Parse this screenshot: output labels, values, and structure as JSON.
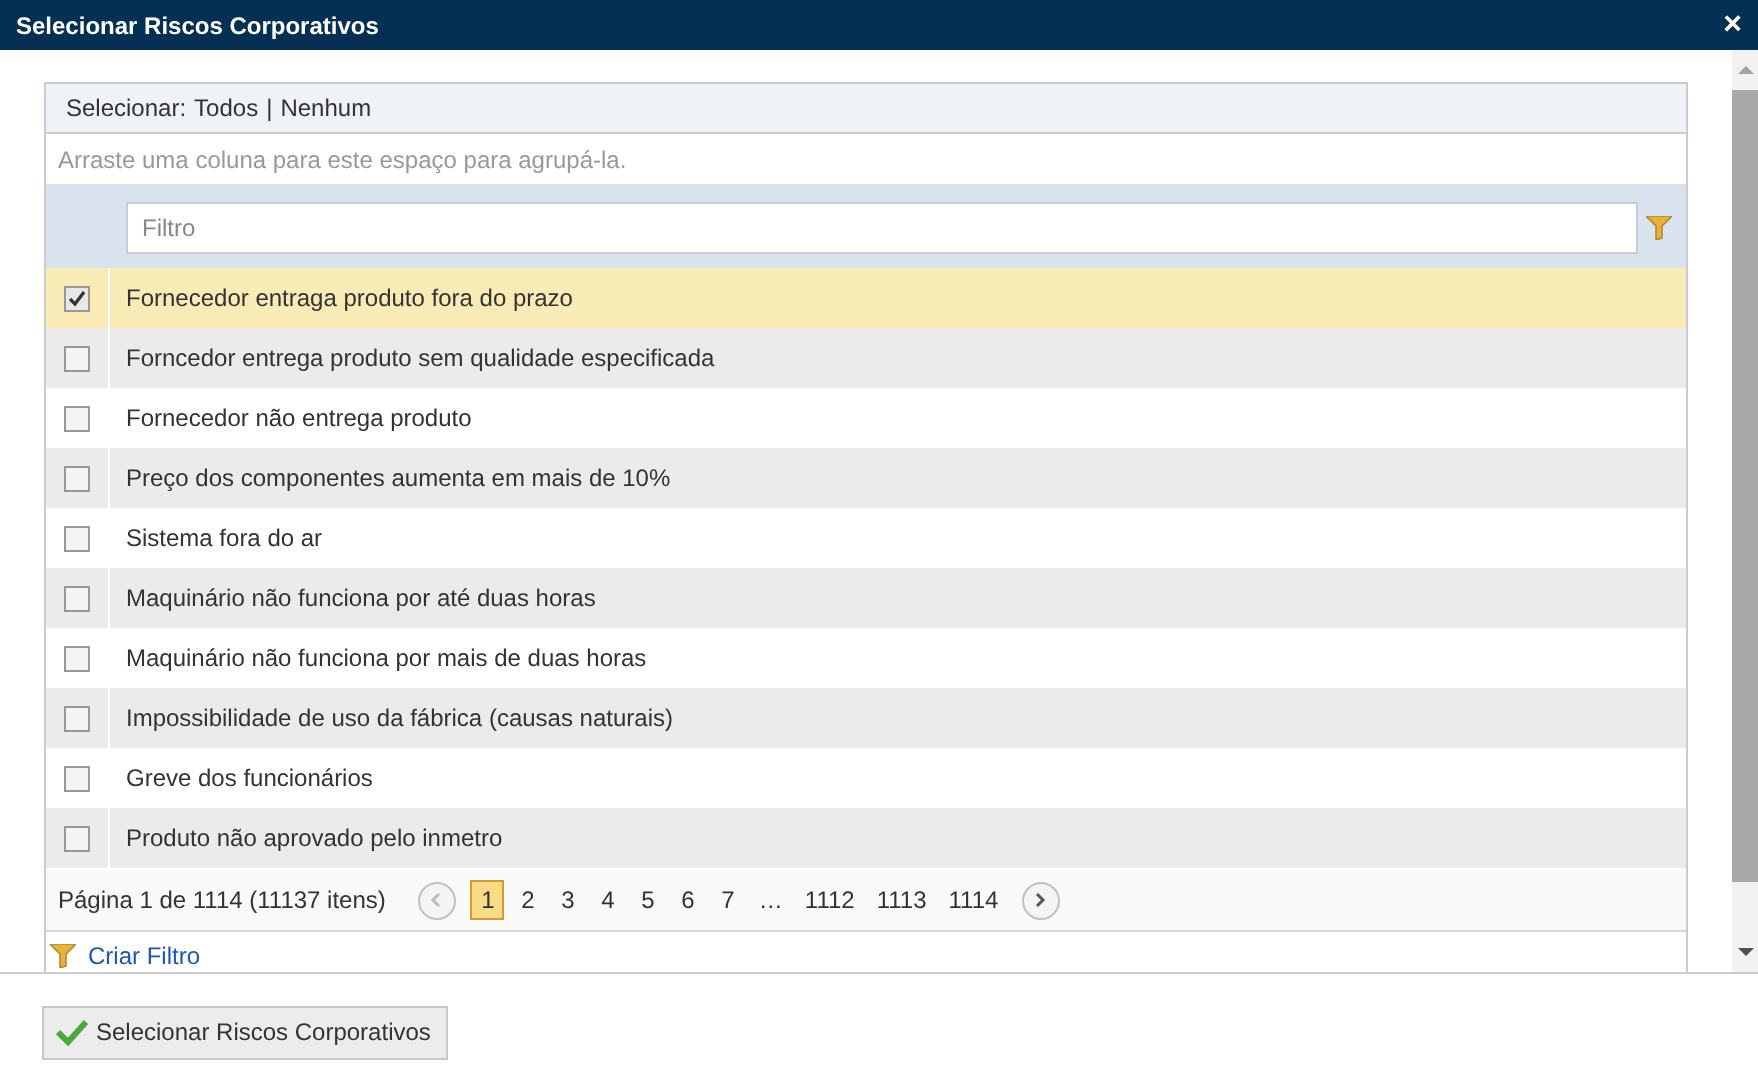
{
  "window": {
    "title": "Selecionar Riscos Corporativos",
    "close": "×"
  },
  "select_bar": {
    "label": "Selecionar:",
    "all": "Todos",
    "separator": "|",
    "none": "Nenhum"
  },
  "group_panel": {
    "hint": "Arraste uma coluna para este espaço para agrupá-la."
  },
  "filter": {
    "placeholder": "Filtro"
  },
  "rows": [
    {
      "text": "Fornecedor entraga produto fora do prazo",
      "checked": true,
      "selected": true
    },
    {
      "text": "Forncedor entrega produto sem qualidade especificada",
      "checked": false,
      "selected": false
    },
    {
      "text": "Fornecedor não entrega produto",
      "checked": false,
      "selected": false
    },
    {
      "text": "Preço dos componentes aumenta em mais de 10%",
      "checked": false,
      "selected": false
    },
    {
      "text": "Sistema fora do ar",
      "checked": false,
      "selected": false
    },
    {
      "text": "Maquinário não funciona por até duas horas",
      "checked": false,
      "selected": false
    },
    {
      "text": "Maquinário não funciona por mais de duas horas",
      "checked": false,
      "selected": false
    },
    {
      "text": "Impossibilidade de uso da fábrica (causas naturais)",
      "checked": false,
      "selected": false
    },
    {
      "text": "Greve dos funcionários",
      "checked": false,
      "selected": false
    },
    {
      "text": "Produto não aprovado pelo inmetro",
      "checked": false,
      "selected": false
    }
  ],
  "pager": {
    "summary": "Página 1 de 1114 (11137 itens)",
    "pages": [
      {
        "label": "1",
        "selected": true
      },
      {
        "label": "2",
        "selected": false
      },
      {
        "label": "3",
        "selected": false
      },
      {
        "label": "4",
        "selected": false
      },
      {
        "label": "5",
        "selected": false
      },
      {
        "label": "6",
        "selected": false
      },
      {
        "label": "7",
        "selected": false
      },
      {
        "label": "…",
        "selected": false
      },
      {
        "label": "1112",
        "selected": false
      },
      {
        "label": "1113",
        "selected": false
      },
      {
        "label": "1114",
        "selected": false
      }
    ]
  },
  "create_filter": "Criar Filtro",
  "footer_button": "Selecionar Riscos Corporativos"
}
